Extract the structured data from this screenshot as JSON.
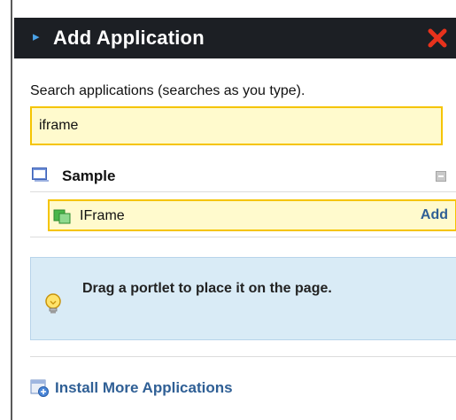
{
  "header": {
    "title": "Add Application",
    "close_icon": "close-icon",
    "expand_icon": "chevron-right-icon"
  },
  "search": {
    "label": "Search applications (searches as you type).",
    "value": "iframe",
    "placeholder": ""
  },
  "category": {
    "name": "Sample",
    "icon": "window-icon",
    "collapse_icon": "minus-icon"
  },
  "results": [
    {
      "name": "IFrame",
      "icon": "portlet-icon",
      "action": "Add"
    }
  ],
  "info": {
    "icon": "lightbulb-icon",
    "text": "Drag a portlet to place it on the page."
  },
  "install": {
    "icon": "install-apps-icon",
    "label": "Install More Applications"
  },
  "colors": {
    "header_bg": "#1c1f24",
    "highlight_bg": "#fffacd",
    "highlight_border": "#f5c400",
    "link": "#2f5f95",
    "info_bg": "#d9ebf6",
    "close_red": "#e8321c"
  }
}
